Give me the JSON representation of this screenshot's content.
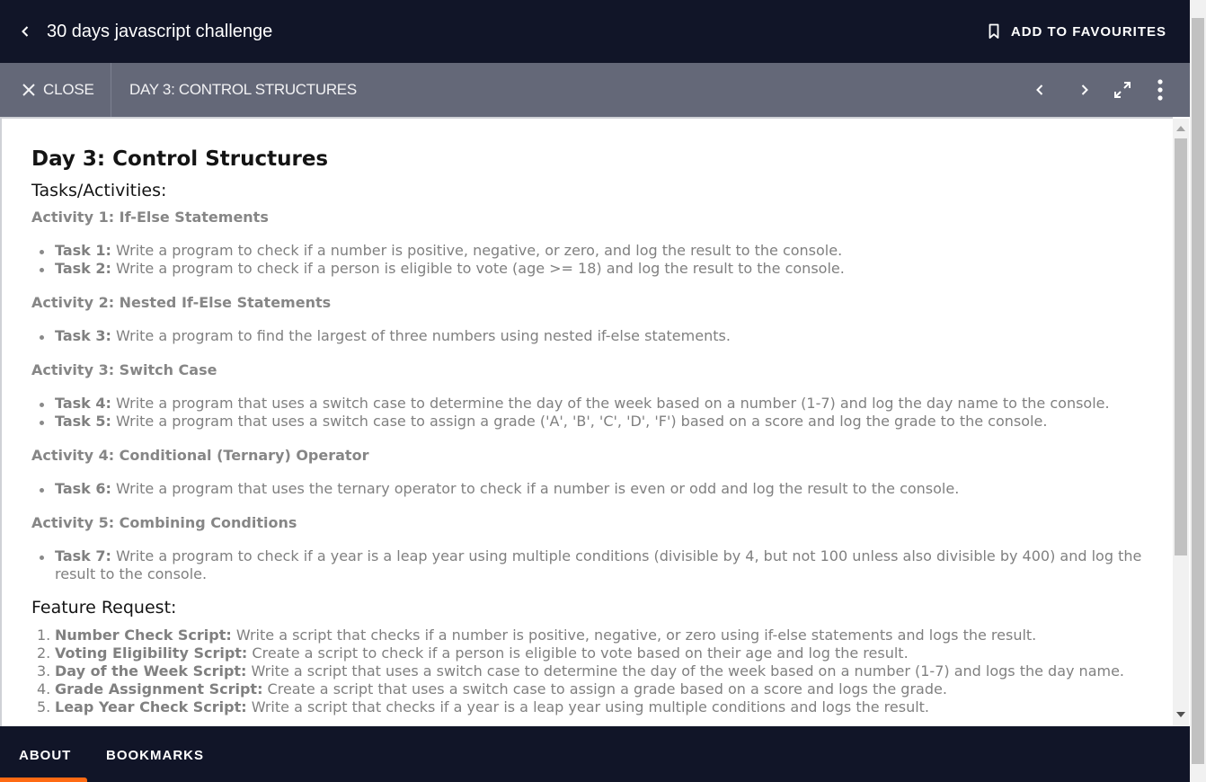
{
  "header": {
    "title": "30 days javascript challenge",
    "favourite_label": "ADD TO FAVOURITES"
  },
  "toolbar": {
    "close_label": "CLOSE",
    "chapter_title": "DAY 3: CONTROL STRUCTURES"
  },
  "doc": {
    "title": "Day 3: Control Structures",
    "tasks_heading": "Tasks/Activities:",
    "activities": [
      {
        "heading": "Activity 1: If-Else Statements",
        "tasks": [
          {
            "label": "Task 1:",
            "text": " Write a program to check if a number is positive, negative, or zero, and log the result to the console."
          },
          {
            "label": "Task 2:",
            "text": " Write a program to check if a person is eligible to vote (age >= 18) and log the result to the console."
          }
        ]
      },
      {
        "heading": "Activity 2: Nested If-Else Statements",
        "tasks": [
          {
            "label": "Task 3:",
            "text": " Write a program to find the largest of three numbers using nested if-else statements."
          }
        ]
      },
      {
        "heading": "Activity 3: Switch Case",
        "tasks": [
          {
            "label": "Task 4:",
            "text": " Write a program that uses a switch case to determine the day of the week based on a number (1-7) and log the day name to the console."
          },
          {
            "label": "Task 5:",
            "text": " Write a program that uses a switch case to assign a grade ('A', 'B', 'C', 'D', 'F') based on a score and log the grade to the console."
          }
        ]
      },
      {
        "heading": "Activity 4: Conditional (Ternary) Operator",
        "tasks": [
          {
            "label": "Task 6:",
            "text": " Write a program that uses the ternary operator to check if a number is even or odd and log the result to the console."
          }
        ]
      },
      {
        "heading": "Activity 5: Combining Conditions",
        "tasks": [
          {
            "label": "Task 7:",
            "text": " Write a program to check if a year is a leap year using multiple conditions (divisible by 4, but not 100 unless also divisible by 400) and log the result to the console."
          }
        ]
      }
    ],
    "feature_heading": "Feature Request:",
    "features": [
      {
        "num": "1.",
        "label": "Number Check Script:",
        "text": " Write a script that checks if a number is positive, negative, or zero using if-else statements and logs the result."
      },
      {
        "num": "2.",
        "label": "Voting Eligibility Script:",
        "text": " Create a script to check if a person is eligible to vote based on their age and log the result."
      },
      {
        "num": "3.",
        "label": "Day of the Week Script:",
        "text": " Write a script that uses a switch case to determine the day of the week based on a number (1-7) and logs the day name."
      },
      {
        "num": "4.",
        "label": "Grade Assignment Script:",
        "text": " Create a script that uses a switch case to assign a grade based on a score and logs the grade."
      },
      {
        "num": "5.",
        "label": "Leap Year Check Script:",
        "text": " Write a script that checks if a year is a leap year using multiple conditions and logs the result."
      }
    ]
  },
  "tabs": {
    "about": "ABOUT",
    "bookmarks": "BOOKMARKS",
    "active_color": "#ff6a13"
  },
  "icons": {
    "back": "chevron-left-icon",
    "favourite": "bookmark-icon",
    "close": "close-icon",
    "prev": "chevron-left-icon",
    "next": "chevron-right-icon",
    "fullscreen": "expand-icon",
    "more": "more-vertical-icon"
  }
}
